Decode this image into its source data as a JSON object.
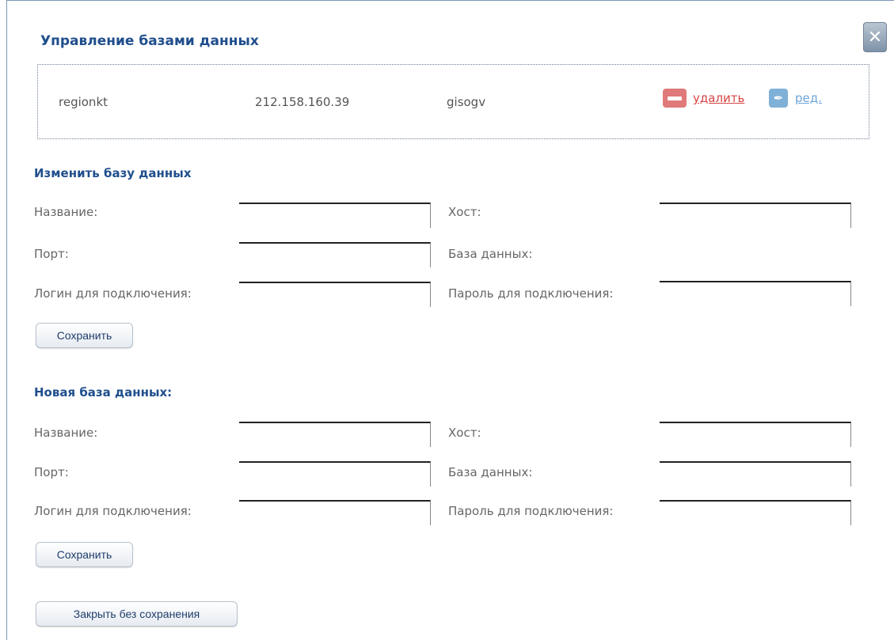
{
  "dialog": {
    "title": "Управление базами данных",
    "close_label": "✕"
  },
  "db_list": {
    "rows": [
      {
        "name": "regionkt",
        "host": "212.158.160.39",
        "database": "gisogv",
        "delete_label": "удалить",
        "edit_label": "ред."
      }
    ]
  },
  "edit_form": {
    "title": "Изменить базу данных",
    "name_label": "Название:",
    "host_label": "Хост:",
    "port_label": "Порт:",
    "database_label": "База данных:",
    "login_label": "Логин для подключения:",
    "password_label": "Пароль для подключения:",
    "name_value": "",
    "host_value": "",
    "port_value": "",
    "login_value": "",
    "password_value": "",
    "save_label": "Сохранить"
  },
  "new_form": {
    "title": "Новая база данных:",
    "name_label": "Название:",
    "host_label": "Хост:",
    "port_label": "Порт:",
    "database_label": "База данных:",
    "login_label": "Логин для подключения:",
    "password_label": "Пароль для подключения:",
    "name_value": "",
    "host_value": "",
    "port_value": "",
    "database_value": "",
    "login_value": "",
    "password_value": "",
    "save_label": "Сохранить"
  },
  "footer": {
    "close_no_save_label": "Закрыть без сохранения"
  },
  "colors": {
    "title": "#1f4e8c",
    "delete": "#d64545",
    "edit": "#6ea5d9",
    "border": "#7a98b8"
  },
  "icons": {
    "close": "close-icon",
    "delete": "minus-icon",
    "edit": "pen-icon"
  }
}
